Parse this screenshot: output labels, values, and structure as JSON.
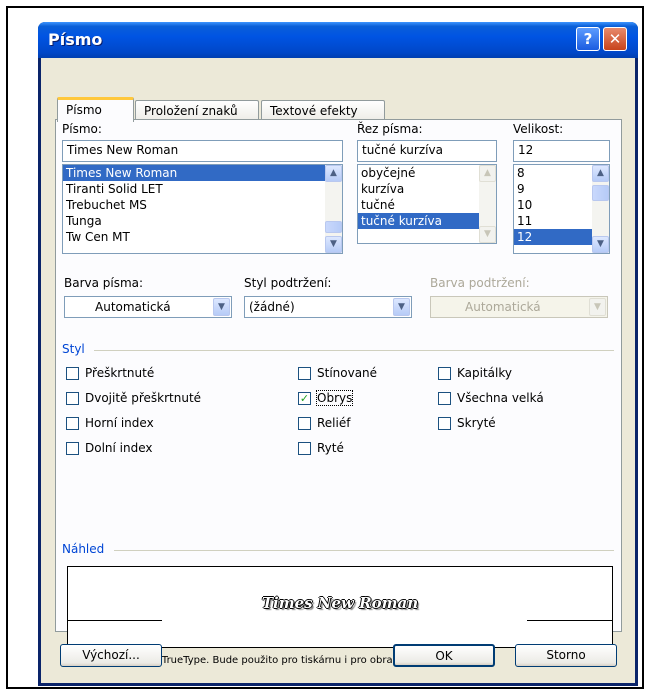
{
  "window": {
    "title": "Písmo",
    "help_glyph": "?",
    "close_glyph": "✕"
  },
  "tabs": [
    "Písmo",
    "Proložení znaků",
    "Textové efekty"
  ],
  "font": {
    "label": "Písmo:",
    "value": "Times New Roman",
    "items": [
      "Times New Roman",
      "Tiranti Solid LET",
      "Trebuchet MS",
      "Tunga",
      "Tw Cen MT"
    ],
    "selected_index": 0
  },
  "style": {
    "label": "Řez písma:",
    "value": "tučné kurzíva",
    "items": [
      "obyčejné",
      "kurzíva",
      "tučné",
      "tučné kurzíva"
    ],
    "selected_index": 3
  },
  "size": {
    "label": "Velikost:",
    "value": "12",
    "items": [
      "8",
      "9",
      "10",
      "11",
      "12"
    ],
    "selected_index": 4
  },
  "font_color": {
    "label": "Barva písma:",
    "value": "Automatická"
  },
  "underline_style": {
    "label": "Styl podtržení:",
    "value": "(žádné)"
  },
  "underline_color": {
    "label": "Barva podtržení:",
    "value": "Automatická"
  },
  "effects": {
    "group_label": "Styl",
    "col1": [
      {
        "label": "Přeškrtnuté",
        "checked": false
      },
      {
        "label": "Dvojitě přeškrtnuté",
        "checked": false
      },
      {
        "label": "Horní index",
        "checked": false
      },
      {
        "label": "Dolní index",
        "checked": false
      }
    ],
    "col2": [
      {
        "label": "Stínované",
        "checked": false
      },
      {
        "label": "Obrys",
        "checked": true
      },
      {
        "label": "Reliéf",
        "checked": false
      },
      {
        "label": "Ryté",
        "checked": false
      }
    ],
    "col3": [
      {
        "label": "Kapitálky",
        "checked": false
      },
      {
        "label": "Všechna velká",
        "checked": false
      },
      {
        "label": "Skryté",
        "checked": false
      }
    ]
  },
  "preview": {
    "group_label": "Náhled",
    "sample_text": "Times New Roman",
    "note": "Toto je písmo typu TrueType. Bude použito pro tiskárnu i pro obrazovku."
  },
  "buttons": {
    "default": "Výchozí...",
    "ok": "OK",
    "cancel": "Storno"
  },
  "glyphs": {
    "up": "▲",
    "down": "▼",
    "check": "✓"
  }
}
